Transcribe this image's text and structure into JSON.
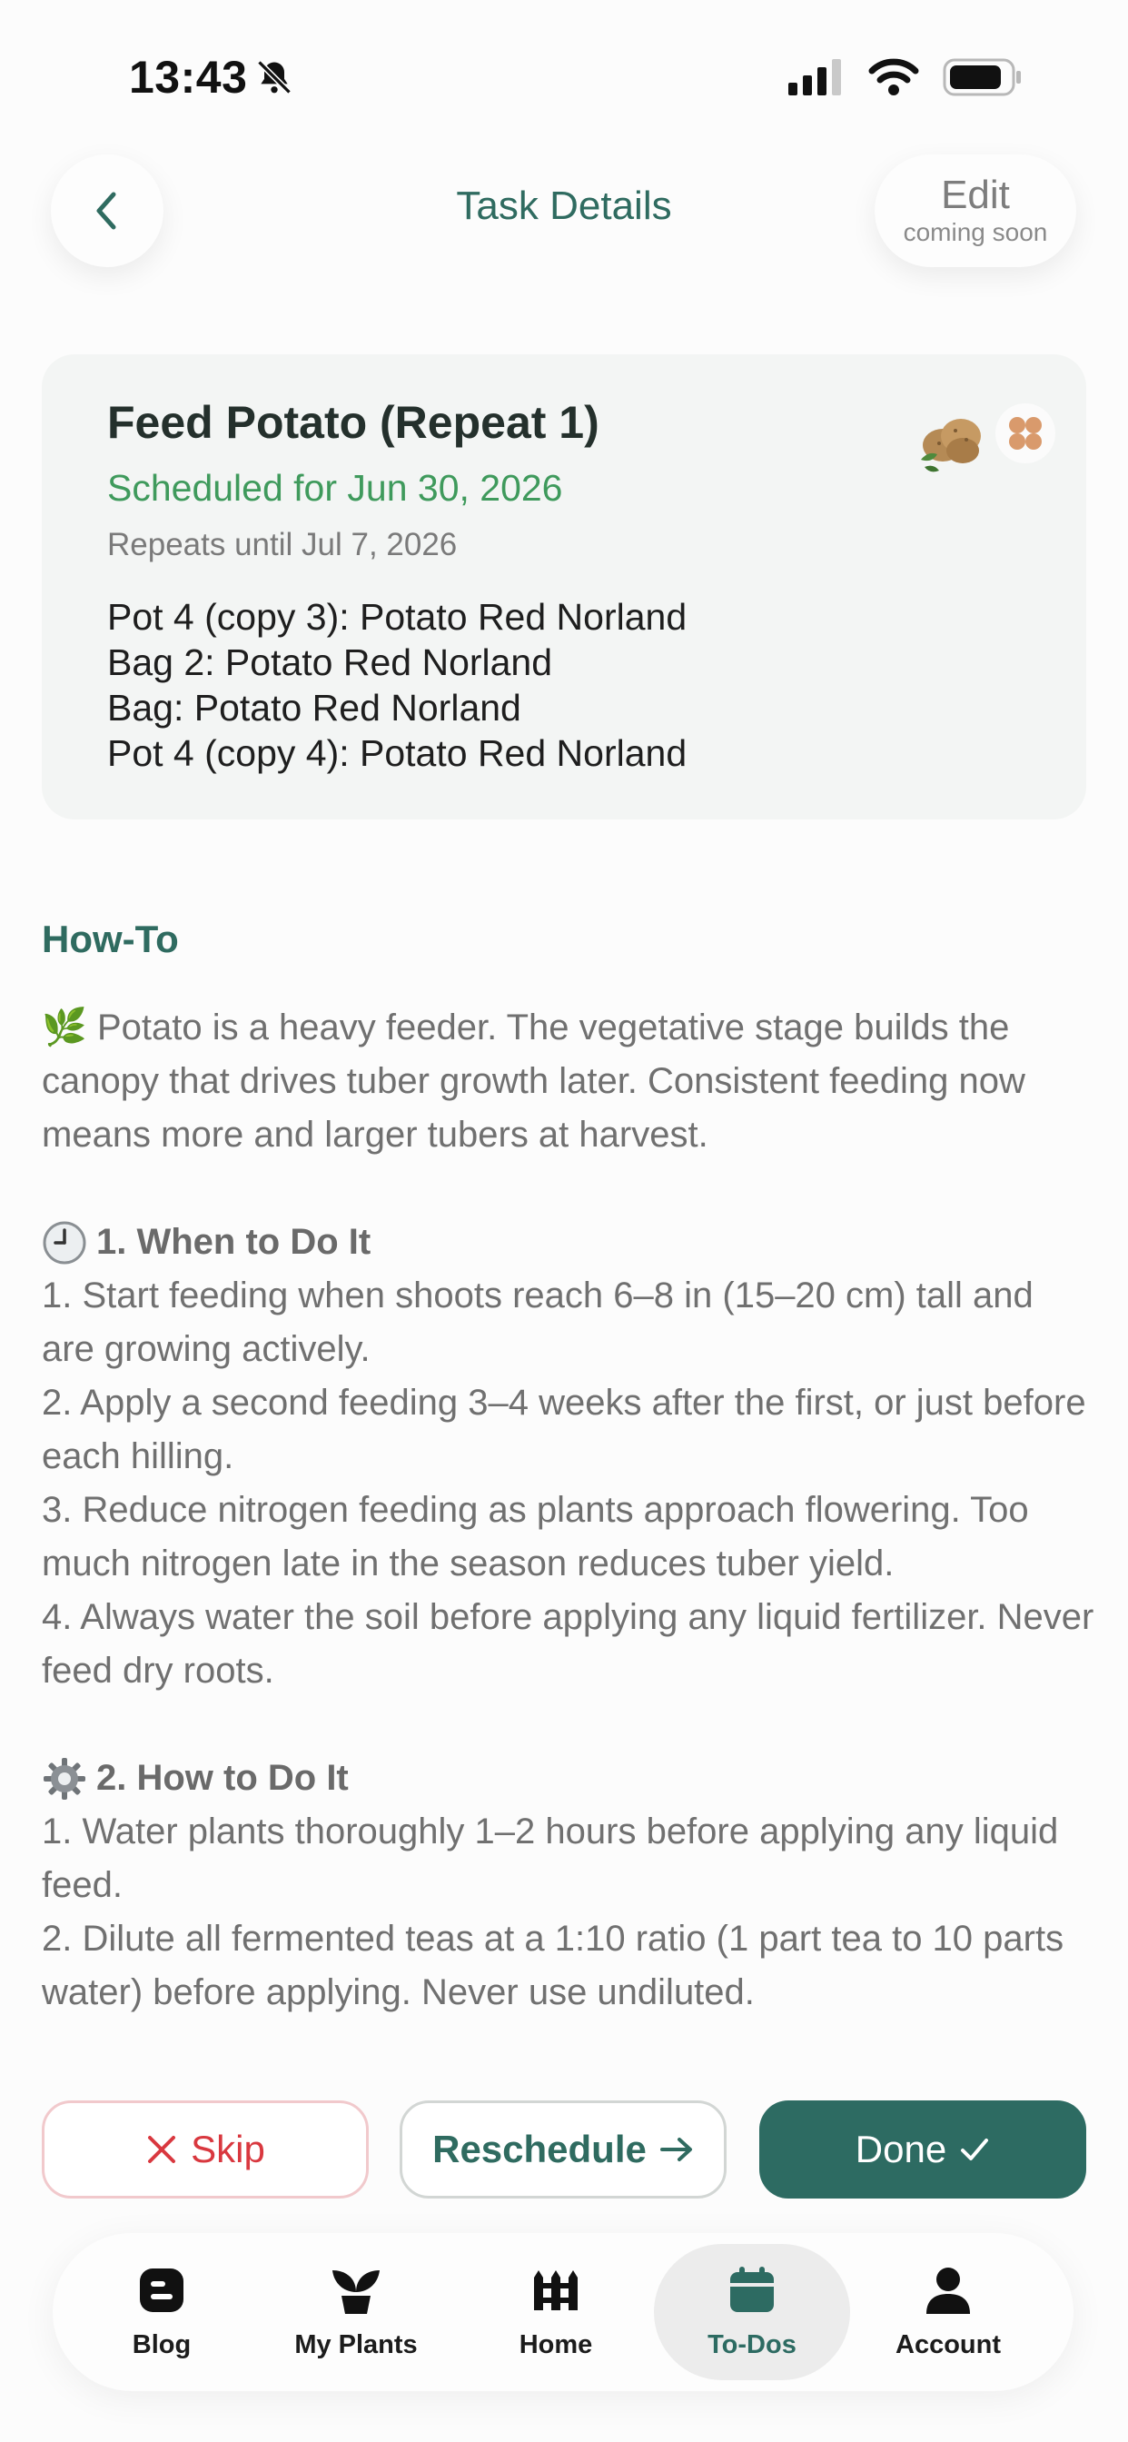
{
  "status_bar": {
    "time": "13:43"
  },
  "header": {
    "title": "Task Details",
    "edit_label": "Edit",
    "edit_sublabel": "coming soon"
  },
  "task": {
    "title": "Feed Potato (Repeat 1)",
    "scheduled": "Scheduled for Jun 30, 2026",
    "repeats": "Repeats until Jul 7, 2026",
    "plants": [
      "Pot 4 (copy 3): Potato Red Norland",
      "Bag 2: Potato Red Norland",
      "Bag: Potato Red Norland",
      "Pot 4 (copy 4): Potato Red Norland"
    ]
  },
  "howto": {
    "heading": "How-To",
    "intro_emoji": "🌿",
    "intro": "Potato is a heavy feeder. The vegetative stage builds the canopy that drives tuber growth later. Consistent feeding now means more and larger tubers at harvest.",
    "when_heading": "1. When to Do It",
    "when_items": [
      "1. Start feeding when shoots reach 6–8 in (15–20 cm) tall and are growing actively.",
      "2. Apply a second feeding 3–4 weeks after the first, or just before each hilling.",
      "3. Reduce nitrogen feeding as plants approach flowering. Too much nitrogen late in the season reduces tuber yield.",
      "4. Always water the soil before applying any liquid fertilizer. Never feed dry roots."
    ],
    "how_heading": "2. How to Do It",
    "how_items": [
      "1. Water plants thoroughly 1–2 hours before applying any liquid feed.",
      "2. Dilute all fermented teas at a 1:10 ratio (1 part tea to 10 parts water) before applying. Never use undiluted."
    ]
  },
  "actions": {
    "skip": "Skip",
    "reschedule": "Reschedule",
    "done": "Done"
  },
  "nav": {
    "items": [
      {
        "label": "Blog",
        "icon": "blog-icon"
      },
      {
        "label": "My Plants",
        "icon": "sprout-icon"
      },
      {
        "label": "Home",
        "icon": "fence-icon"
      },
      {
        "label": "To-Dos",
        "icon": "calendar-icon",
        "active": true
      },
      {
        "label": "Account",
        "icon": "person-icon"
      }
    ]
  },
  "colors": {
    "accent": "#2d6b62",
    "scheduled_green": "#3f9a5c",
    "skip_red": "#d9383f"
  }
}
